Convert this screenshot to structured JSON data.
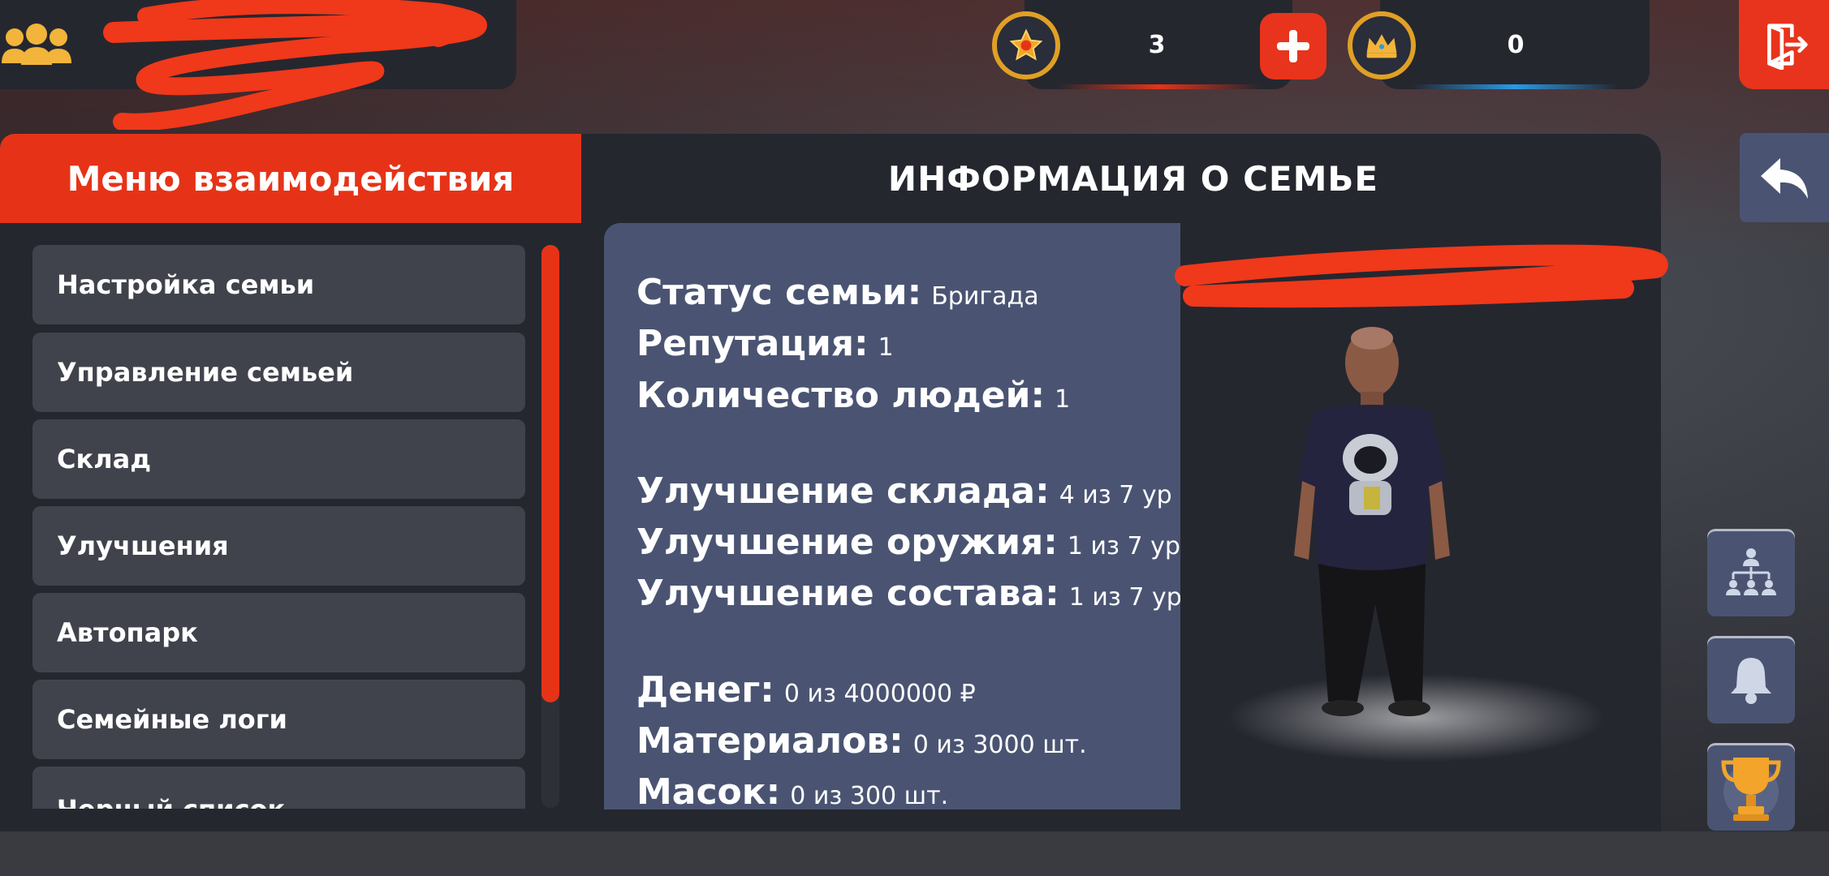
{
  "header": {
    "stars_value": "3",
    "crowns_value": "0"
  },
  "menu": {
    "title": "Меню взаимодействия",
    "items": [
      {
        "label": "Настройка семьи"
      },
      {
        "label": "Управление семьей"
      },
      {
        "label": "Склад"
      },
      {
        "label": "Улучшения"
      },
      {
        "label": "Автопарк"
      },
      {
        "label": "Семейные логи"
      },
      {
        "label": "Черный список"
      }
    ]
  },
  "info": {
    "title": "ИНФОРМАЦИЯ О СЕМЬЕ",
    "status_label": "Статус семьи:",
    "status_value": "Бригада",
    "reputation_label": "Репутация:",
    "reputation_value": "1",
    "people_label": "Количество людей:",
    "people_value": "1",
    "storage_upgrade_label": "Улучшение склада:",
    "storage_upgrade_value": "4 из 7 ур",
    "weapon_upgrade_label": "Улучшение оружия:",
    "weapon_upgrade_value": "1 из 7 ур",
    "squad_upgrade_label": "Улучшение состава:",
    "squad_upgrade_value": "1 из 7 ур",
    "money_label": "Денег:",
    "money_value": "0 из 4000000 ₽",
    "materials_label": "Материалов:",
    "materials_value": "0 из 3000 шт.",
    "masks_label": "Масок:",
    "masks_value": "0 из 300 шт."
  },
  "colors": {
    "accent": "#e63318",
    "panel": "#25272f",
    "card": "#4a5472",
    "menu_item": "#41434c"
  },
  "icons": {
    "family": "family-icon",
    "star": "star-icon",
    "crown": "crown-icon",
    "plus": "plus-icon",
    "exit": "exit-door-icon",
    "back": "back-arrow-icon",
    "hierarchy": "hierarchy-icon",
    "bell": "bell-icon",
    "trophy": "trophy-icon"
  }
}
